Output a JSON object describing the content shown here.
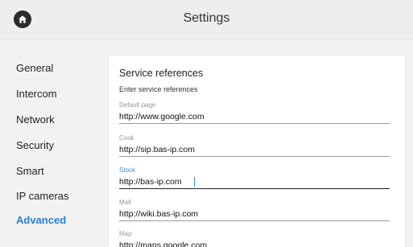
{
  "header": {
    "title": "Settings",
    "home_icon": "home-icon"
  },
  "sidebar": {
    "items": [
      {
        "label": "General"
      },
      {
        "label": "Intercom"
      },
      {
        "label": "Network"
      },
      {
        "label": "Security"
      },
      {
        "label": "Smart"
      },
      {
        "label": "IP cameras"
      },
      {
        "label": "Advanced",
        "active": true
      }
    ]
  },
  "panel": {
    "title": "Service references",
    "subtitle": "Enter service references",
    "fields": [
      {
        "label": "Default page",
        "value": "http://www.google.com"
      },
      {
        "label": "Cook",
        "value": "http://sip.bas-ip.com"
      },
      {
        "label": "Stock",
        "value": "http://bas-ip.com",
        "focused": true
      },
      {
        "label": "Mall",
        "value": "http://wiki.bas-ip.com"
      },
      {
        "label": "Map",
        "value": "http://maps.google.com"
      }
    ]
  },
  "colors": {
    "accent": "#2a7fd4",
    "focus_label": "#3a8fd8",
    "background": "#f2f2f2",
    "panel": "#ffffff"
  }
}
